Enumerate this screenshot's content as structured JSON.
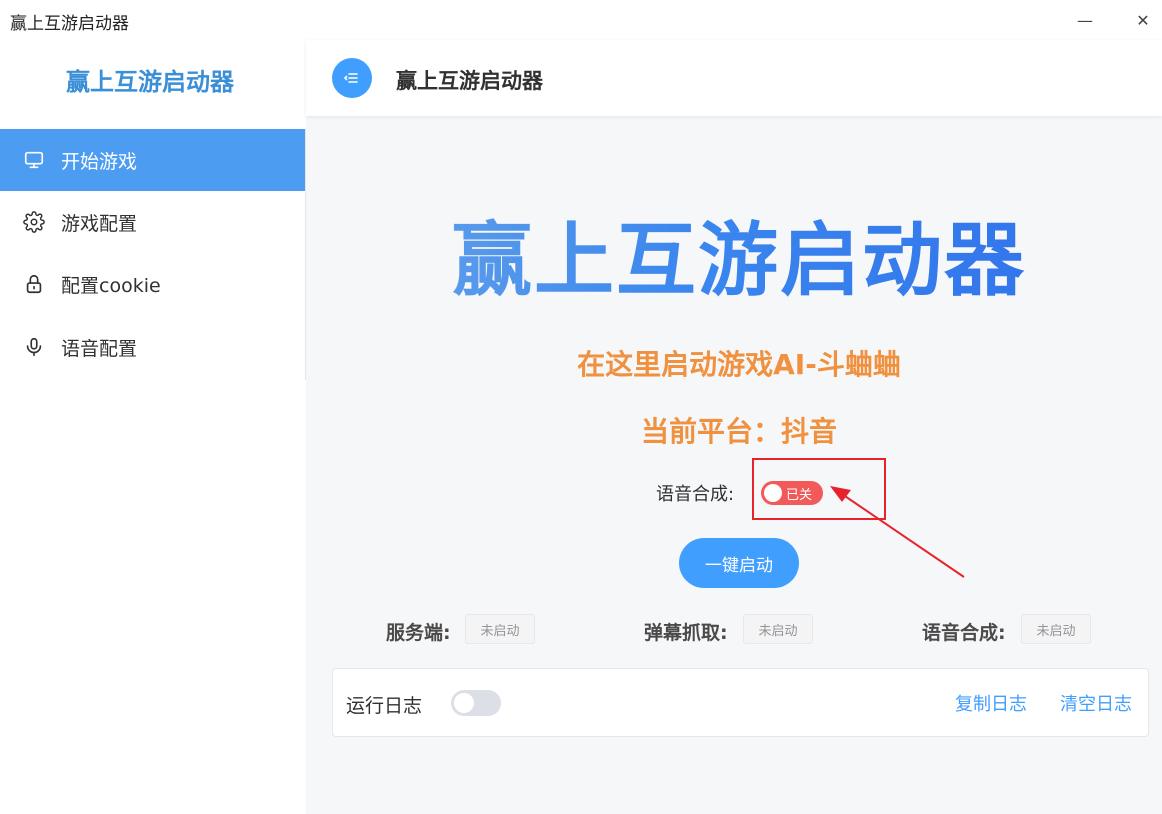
{
  "window": {
    "title": "赢上互游启动器",
    "minimize": "—",
    "close": "✕"
  },
  "sidebar": {
    "brand": "赢上互游启动器",
    "items": [
      {
        "label": "开始游戏",
        "icon": "monitor-icon",
        "active": true
      },
      {
        "label": "游戏配置",
        "icon": "gear-icon",
        "active": false
      },
      {
        "label": "配置cookie",
        "icon": "lock-icon",
        "active": false
      },
      {
        "label": "语音配置",
        "icon": "microphone-icon",
        "active": false
      }
    ]
  },
  "header": {
    "title": "赢上互游启动器",
    "menu_icon": "menu-toggle-icon"
  },
  "main": {
    "hero_title": "赢上互游启动器",
    "subtitle": "在这里启动游戏AI-斗蛐蛐",
    "platform_line": "当前平台：抖音",
    "tts": {
      "label": "语音合成:",
      "switch_text": "已关",
      "switch_state": "on"
    },
    "launch_button": "一键启动",
    "statuses": [
      {
        "label": "服务端:",
        "value": "未启动"
      },
      {
        "label": "弹幕抓取:",
        "value": "未启动"
      },
      {
        "label": "语音合成:",
        "value": "未启动"
      }
    ],
    "log": {
      "title": "运行日志",
      "toggle_state": "off",
      "copy_label": "复制日志",
      "clear_label": "清空日志"
    }
  },
  "colors": {
    "accent": "#409eff",
    "active_menu": "#4c9cf1",
    "orange": "#f0913f",
    "switch_red": "#f25a5a",
    "highlight": "#e8222b"
  }
}
